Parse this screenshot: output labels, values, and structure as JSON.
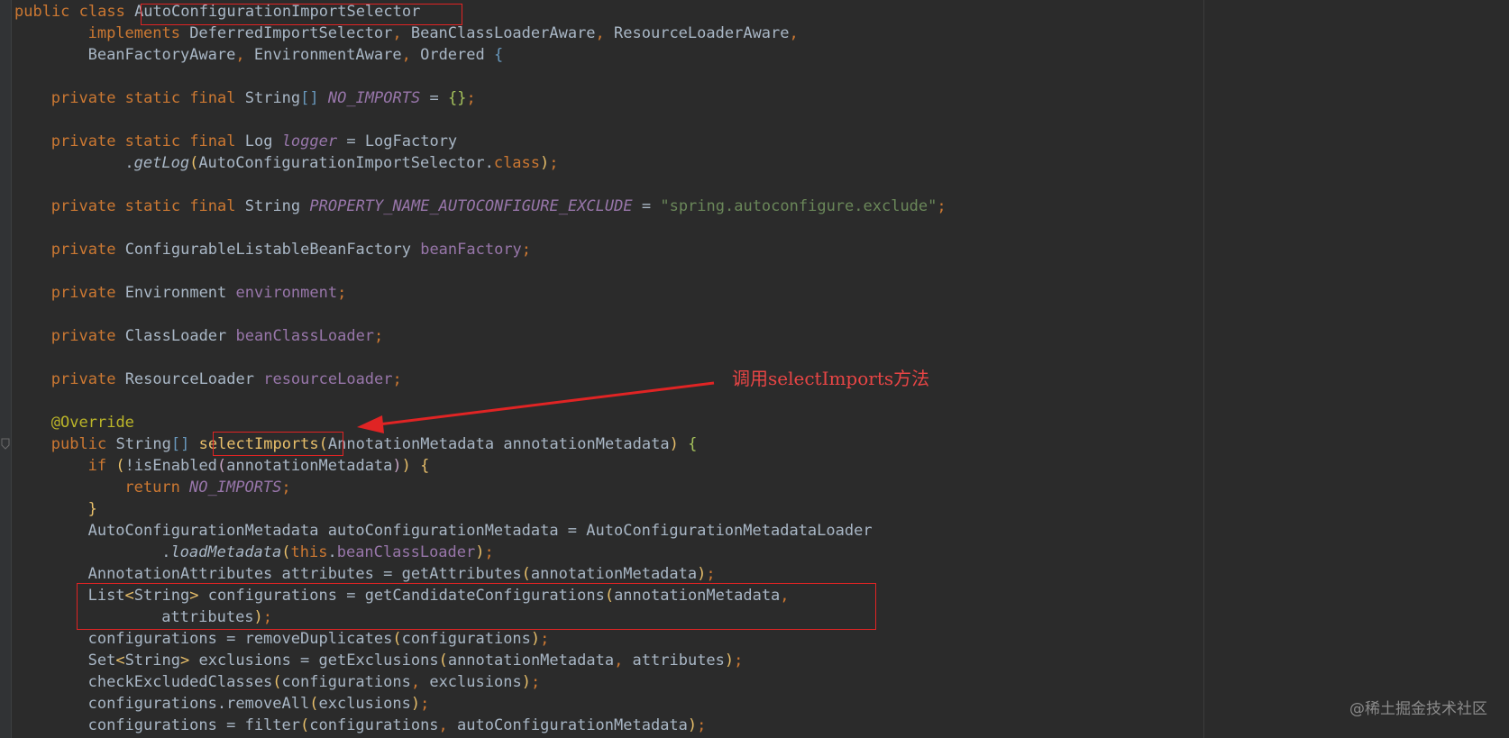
{
  "code_lines": [
    {
      "indent": 0,
      "tokens": [
        {
          "t": "public class ",
          "c": "kw"
        },
        {
          "t": "AutoConfigurationImportSelector",
          "c": "plain"
        }
      ]
    },
    {
      "indent": 8,
      "tokens": [
        {
          "t": "implements ",
          "c": "kw"
        },
        {
          "t": "DeferredImportSelector",
          "c": "plain"
        },
        {
          "t": ", ",
          "c": "kw"
        },
        {
          "t": "BeanClassLoaderAware",
          "c": "plain"
        },
        {
          "t": ", ",
          "c": "kw"
        },
        {
          "t": "ResourceLoaderAware",
          "c": "plain"
        },
        {
          "t": ",",
          "c": "kw"
        }
      ]
    },
    {
      "indent": 8,
      "tokens": [
        {
          "t": "BeanFactoryAware",
          "c": "plain"
        },
        {
          "t": ", ",
          "c": "kw"
        },
        {
          "t": "EnvironmentAware",
          "c": "plain"
        },
        {
          "t": ", ",
          "c": "kw"
        },
        {
          "t": "Ordered ",
          "c": "plain"
        },
        {
          "t": "{",
          "c": "br3"
        }
      ]
    },
    {
      "indent": 0,
      "tokens": []
    },
    {
      "indent": 4,
      "tokens": [
        {
          "t": "private static final ",
          "c": "kw"
        },
        {
          "t": "String",
          "c": "plain"
        },
        {
          "t": "[] ",
          "c": "br3"
        },
        {
          "t": "NO_IMPORTS",
          "c": "sfield"
        },
        {
          "t": " = ",
          "c": "plain"
        },
        {
          "t": "{}",
          "c": "br4"
        },
        {
          "t": ";",
          "c": "kw"
        }
      ]
    },
    {
      "indent": 0,
      "tokens": []
    },
    {
      "indent": 4,
      "tokens": [
        {
          "t": "private static final ",
          "c": "kw"
        },
        {
          "t": "Log ",
          "c": "plain"
        },
        {
          "t": "logger",
          "c": "sfield"
        },
        {
          "t": " = LogFactory",
          "c": "plain"
        }
      ]
    },
    {
      "indent": 12,
      "tokens": [
        {
          "t": ".",
          "c": "plain"
        },
        {
          "t": "getLog",
          "c": "smethod"
        },
        {
          "t": "(",
          "c": "br1"
        },
        {
          "t": "AutoConfigurationImportSelector.",
          "c": "plain"
        },
        {
          "t": "class",
          "c": "kw"
        },
        {
          "t": ")",
          "c": "br1"
        },
        {
          "t": ";",
          "c": "kw"
        }
      ]
    },
    {
      "indent": 0,
      "tokens": []
    },
    {
      "indent": 4,
      "tokens": [
        {
          "t": "private static final ",
          "c": "kw"
        },
        {
          "t": "String ",
          "c": "plain"
        },
        {
          "t": "PROPERTY_NAME_AUTOCONFIGURE_EXCLUDE",
          "c": "sfield"
        },
        {
          "t": " = ",
          "c": "plain"
        },
        {
          "t": "\"spring.autoconfigure.exclude\"",
          "c": "str"
        },
        {
          "t": ";",
          "c": "kw"
        }
      ]
    },
    {
      "indent": 0,
      "tokens": []
    },
    {
      "indent": 4,
      "tokens": [
        {
          "t": "private ",
          "c": "kw"
        },
        {
          "t": "ConfigurableListableBeanFactory ",
          "c": "plain"
        },
        {
          "t": "beanFactory",
          "c": "field"
        },
        {
          "t": ";",
          "c": "kw"
        }
      ]
    },
    {
      "indent": 0,
      "tokens": []
    },
    {
      "indent": 4,
      "tokens": [
        {
          "t": "private ",
          "c": "kw"
        },
        {
          "t": "Environment ",
          "c": "plain"
        },
        {
          "t": "environment",
          "c": "field"
        },
        {
          "t": ";",
          "c": "kw"
        }
      ]
    },
    {
      "indent": 0,
      "tokens": []
    },
    {
      "indent": 4,
      "tokens": [
        {
          "t": "private ",
          "c": "kw"
        },
        {
          "t": "ClassLoader ",
          "c": "plain"
        },
        {
          "t": "beanClassLoader",
          "c": "field"
        },
        {
          "t": ";",
          "c": "kw"
        }
      ]
    },
    {
      "indent": 0,
      "tokens": []
    },
    {
      "indent": 4,
      "tokens": [
        {
          "t": "private ",
          "c": "kw"
        },
        {
          "t": "ResourceLoader ",
          "c": "plain"
        },
        {
          "t": "resourceLoader",
          "c": "field"
        },
        {
          "t": ";",
          "c": "kw"
        }
      ]
    },
    {
      "indent": 0,
      "tokens": []
    },
    {
      "indent": 4,
      "tokens": [
        {
          "t": "@Override",
          "c": "ann"
        }
      ]
    },
    {
      "indent": 4,
      "tokens": [
        {
          "t": "public ",
          "c": "kw"
        },
        {
          "t": "String",
          "c": "plain"
        },
        {
          "t": "[] ",
          "c": "br3"
        },
        {
          "t": "selectImports",
          "c": "br1"
        },
        {
          "t": "(",
          "c": "br1"
        },
        {
          "t": "AnnotationMetadata annotationMetadata",
          "c": "plain"
        },
        {
          "t": ") ",
          "c": "br1"
        },
        {
          "t": "{",
          "c": "br4"
        }
      ]
    },
    {
      "indent": 8,
      "tokens": [
        {
          "t": "if ",
          "c": "kw"
        },
        {
          "t": "(",
          "c": "br1"
        },
        {
          "t": "!isEnabled",
          "c": "plain"
        },
        {
          "t": "(",
          "c": "br2"
        },
        {
          "t": "annotationMetadata",
          "c": "plain"
        },
        {
          "t": ")",
          "c": "br2"
        },
        {
          "t": ")",
          "c": "br1"
        },
        {
          "t": " ",
          "c": "plain"
        },
        {
          "t": "{",
          "c": "br1"
        }
      ]
    },
    {
      "indent": 12,
      "tokens": [
        {
          "t": "return ",
          "c": "kw"
        },
        {
          "t": "NO_IMPORTS",
          "c": "sfield"
        },
        {
          "t": ";",
          "c": "kw"
        }
      ]
    },
    {
      "indent": 8,
      "tokens": [
        {
          "t": "}",
          "c": "br1"
        }
      ]
    },
    {
      "indent": 8,
      "tokens": [
        {
          "t": "AutoConfigurationMetadata autoConfigurationMetadata = AutoConfigurationMetadataLoader",
          "c": "plain"
        }
      ]
    },
    {
      "indent": 16,
      "tokens": [
        {
          "t": ".",
          "c": "plain"
        },
        {
          "t": "loadMetadata",
          "c": "smethod"
        },
        {
          "t": "(",
          "c": "br1"
        },
        {
          "t": "this",
          "c": "kw"
        },
        {
          "t": ".",
          "c": "plain"
        },
        {
          "t": "beanClassLoader",
          "c": "field"
        },
        {
          "t": ")",
          "c": "br1"
        },
        {
          "t": ";",
          "c": "kw"
        }
      ]
    },
    {
      "indent": 8,
      "tokens": [
        {
          "t": "AnnotationAttributes attributes = getAttributes",
          "c": "plain"
        },
        {
          "t": "(",
          "c": "br1"
        },
        {
          "t": "annotationMetadata",
          "c": "plain"
        },
        {
          "t": ")",
          "c": "br1"
        },
        {
          "t": ";",
          "c": "kw"
        }
      ]
    },
    {
      "indent": 8,
      "tokens": [
        {
          "t": "List",
          "c": "plain"
        },
        {
          "t": "<",
          "c": "br1"
        },
        {
          "t": "String",
          "c": "plain"
        },
        {
          "t": "> ",
          "c": "br1"
        },
        {
          "t": "configurations = getCandidateConfigurations",
          "c": "plain"
        },
        {
          "t": "(",
          "c": "br1"
        },
        {
          "t": "annotationMetadata",
          "c": "plain"
        },
        {
          "t": ",",
          "c": "kw"
        }
      ]
    },
    {
      "indent": 16,
      "tokens": [
        {
          "t": "attributes",
          "c": "plain"
        },
        {
          "t": ")",
          "c": "br1"
        },
        {
          "t": ";",
          "c": "kw"
        }
      ]
    },
    {
      "indent": 8,
      "tokens": [
        {
          "t": "configurations = removeDuplicates",
          "c": "plain"
        },
        {
          "t": "(",
          "c": "br1"
        },
        {
          "t": "configurations",
          "c": "plain"
        },
        {
          "t": ")",
          "c": "br1"
        },
        {
          "t": ";",
          "c": "kw"
        }
      ]
    },
    {
      "indent": 8,
      "tokens": [
        {
          "t": "Set",
          "c": "plain"
        },
        {
          "t": "<",
          "c": "br1"
        },
        {
          "t": "String",
          "c": "plain"
        },
        {
          "t": "> ",
          "c": "br1"
        },
        {
          "t": "exclusions = getExclusions",
          "c": "plain"
        },
        {
          "t": "(",
          "c": "br1"
        },
        {
          "t": "annotationMetadata",
          "c": "plain"
        },
        {
          "t": ", ",
          "c": "kw"
        },
        {
          "t": "attributes",
          "c": "plain"
        },
        {
          "t": ")",
          "c": "br1"
        },
        {
          "t": ";",
          "c": "kw"
        }
      ]
    },
    {
      "indent": 8,
      "tokens": [
        {
          "t": "checkExcludedClasses",
          "c": "plain"
        },
        {
          "t": "(",
          "c": "br1"
        },
        {
          "t": "configurations",
          "c": "plain"
        },
        {
          "t": ", ",
          "c": "kw"
        },
        {
          "t": "exclusions",
          "c": "plain"
        },
        {
          "t": ")",
          "c": "br1"
        },
        {
          "t": ";",
          "c": "kw"
        }
      ]
    },
    {
      "indent": 8,
      "tokens": [
        {
          "t": "configurations.removeAll",
          "c": "plain"
        },
        {
          "t": "(",
          "c": "br1"
        },
        {
          "t": "exclusions",
          "c": "plain"
        },
        {
          "t": ")",
          "c": "br1"
        },
        {
          "t": ";",
          "c": "kw"
        }
      ]
    },
    {
      "indent": 8,
      "tokens": [
        {
          "t": "configurations = filter",
          "c": "plain"
        },
        {
          "t": "(",
          "c": "br1"
        },
        {
          "t": "configurations",
          "c": "plain"
        },
        {
          "t": ", ",
          "c": "kw"
        },
        {
          "t": "autoConfigurationMetadata",
          "c": "plain"
        },
        {
          "t": ")",
          "c": "br1"
        },
        {
          "t": ";",
          "c": "kw"
        }
      ]
    }
  ],
  "annotation": {
    "note_text": "调用selectImports方法",
    "color": "#e02424"
  },
  "watermark": "@稀土掘金技术社区",
  "colors": {
    "background": "#2b2b2b",
    "keyword": "#cc7832",
    "plain": "#a9b7c6",
    "field": "#9876aa",
    "string": "#6a8759",
    "annotation": "#bbb529"
  }
}
